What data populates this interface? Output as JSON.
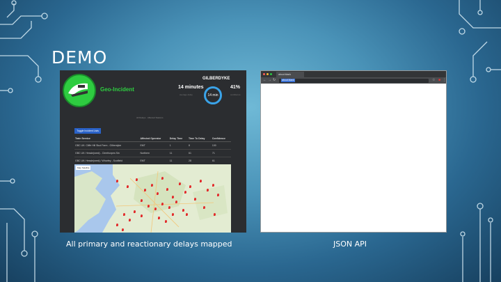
{
  "slide": {
    "title": "DEMO",
    "caption_left": "All primary and reactionary delays mapped",
    "caption_right": "JSON API"
  },
  "dashboard": {
    "brand": "Geo-Incident",
    "station": "GILBERDYKE",
    "delay_value": "14 minutes",
    "delay_sub": "average delay",
    "gauge_text": "14 min",
    "confidence_pct": "41%",
    "confidence_sub": "confidence",
    "center_note": "All Delays · Affected Stations",
    "toggle_label": "Toggle Incident Lists",
    "table": {
      "headers": [
        "Train Service",
        "Affected Operator",
        "Delay Time",
        "Time To Delay",
        "Confidence"
      ],
      "rows": [
        [
          "GBC UK: Cliffe Hill Stud Farm - Gilberdyke",
          "EMT",
          "1",
          "8",
          "100"
        ],
        [
          "GBC UK: Hessle(west) - Cleethorpes Stn",
          "Northern",
          "11",
          "61",
          "71"
        ],
        [
          "GBC UK: Hessle(west) / Wharfey - Scotfield",
          "EMT",
          "11",
          "28",
          "61"
        ]
      ]
    },
    "map_types": [
      "Map",
      "Satellite"
    ]
  },
  "browser": {
    "tab_title": "about:blank",
    "url": "about:blank"
  },
  "colors": {
    "brand_green": "#2ecc40",
    "accent_blue": "#3aa3e8",
    "pin_red": "#e22b2b"
  }
}
